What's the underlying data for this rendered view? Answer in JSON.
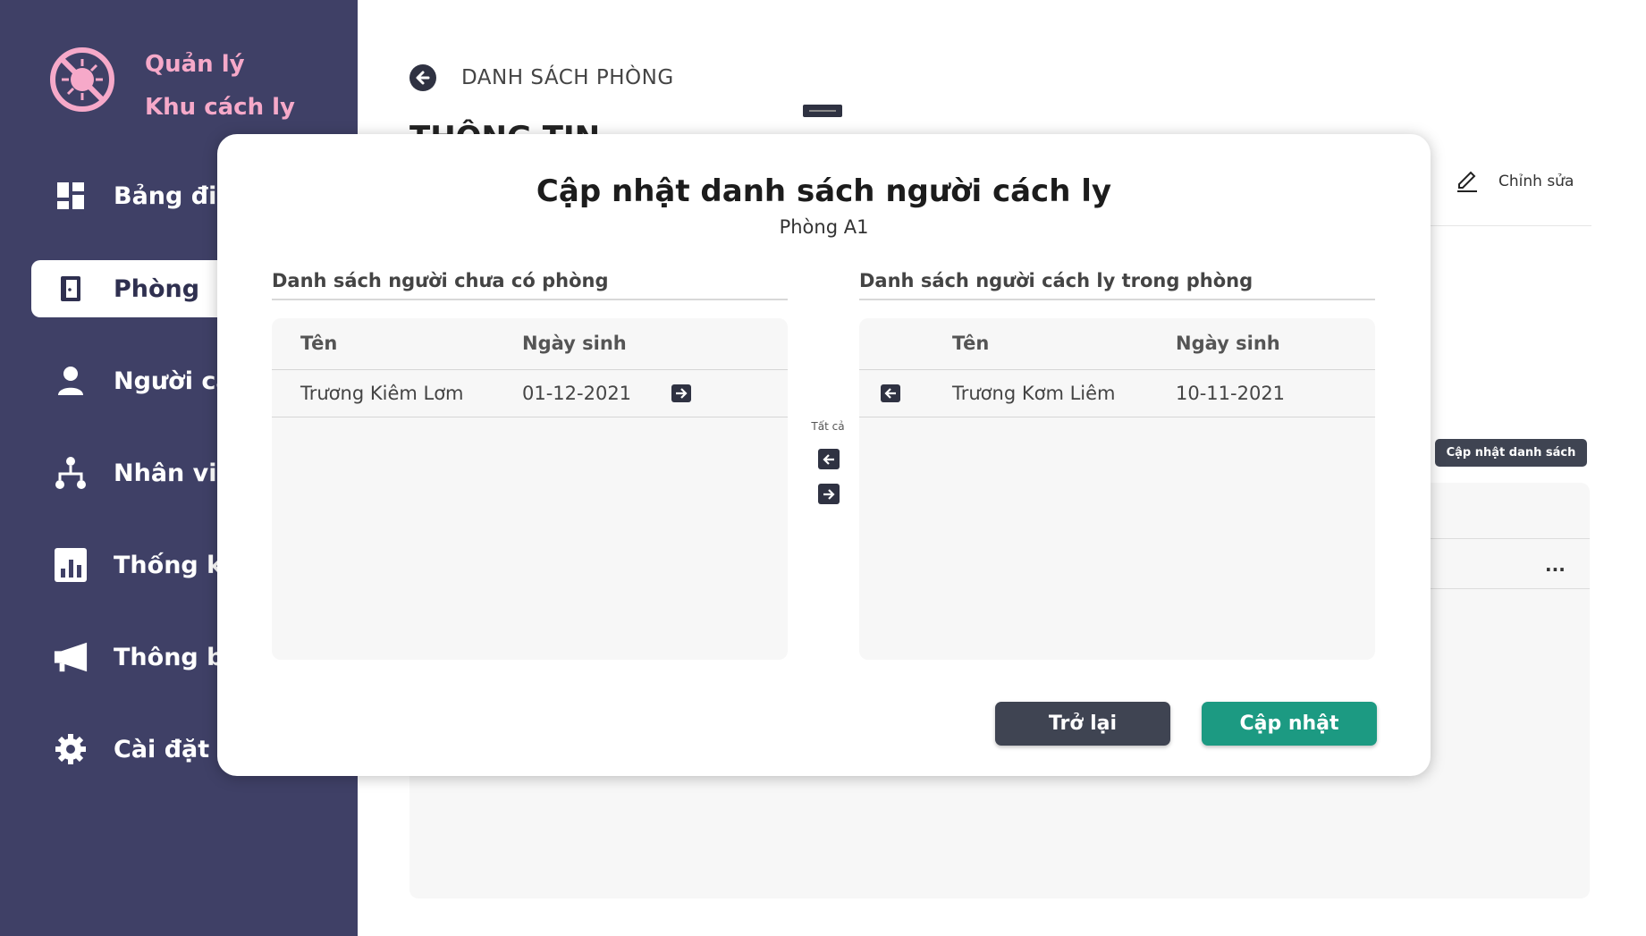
{
  "brand": {
    "line1": "Quản lý",
    "line2": "Khu cách ly",
    "logo_icon": "virus-blocked-icon"
  },
  "sidebar": {
    "items": [
      {
        "label": "Bảng điều",
        "icon": "dashboard-icon",
        "active": false
      },
      {
        "label": "Phòng",
        "icon": "door-icon",
        "active": true
      },
      {
        "label": "Người các",
        "icon": "person-icon",
        "active": false
      },
      {
        "label": "Nhân viên",
        "icon": "org-chart-icon",
        "active": false
      },
      {
        "label": "Thống kê",
        "icon": "bar-chart-icon",
        "active": false
      },
      {
        "label": "Thông bá",
        "icon": "megaphone-icon",
        "active": false
      },
      {
        "label": "Cài đặt",
        "icon": "gear-icon",
        "active": false
      }
    ]
  },
  "header": {
    "back_label": "DANH SÁCH PHÒNG",
    "section_title_partial": "THÔNG TIN",
    "edit_label": "Chỉnh sửa"
  },
  "background": {
    "update_list_label": "Cập nhật danh sách",
    "more_label": "..."
  },
  "modal": {
    "title": "Cập nhật danh sách người cách ly",
    "subtitle": "Phòng A1",
    "left": {
      "heading": "Danh sách người chưa có phòng",
      "columns": [
        "Tên",
        "Ngày sinh"
      ],
      "rows": [
        {
          "name": "Trương Kiêm Lơm",
          "dob": "01-12-2021"
        }
      ]
    },
    "right": {
      "heading": "Danh sách người cách ly trong phòng",
      "columns": [
        "Tên",
        "Ngày sinh"
      ],
      "rows": [
        {
          "name": "Trương Kơm Liêm",
          "dob": "10-11-2021"
        }
      ]
    },
    "all_label": "Tất cả",
    "back_button": "Trở lại",
    "update_button": "Cập nhật"
  },
  "colors": {
    "sidebar_bg": "#3f4066",
    "brand_pink": "#f6a9c9",
    "primary_teal": "#1c9a82",
    "dark_button": "#3f4452"
  }
}
